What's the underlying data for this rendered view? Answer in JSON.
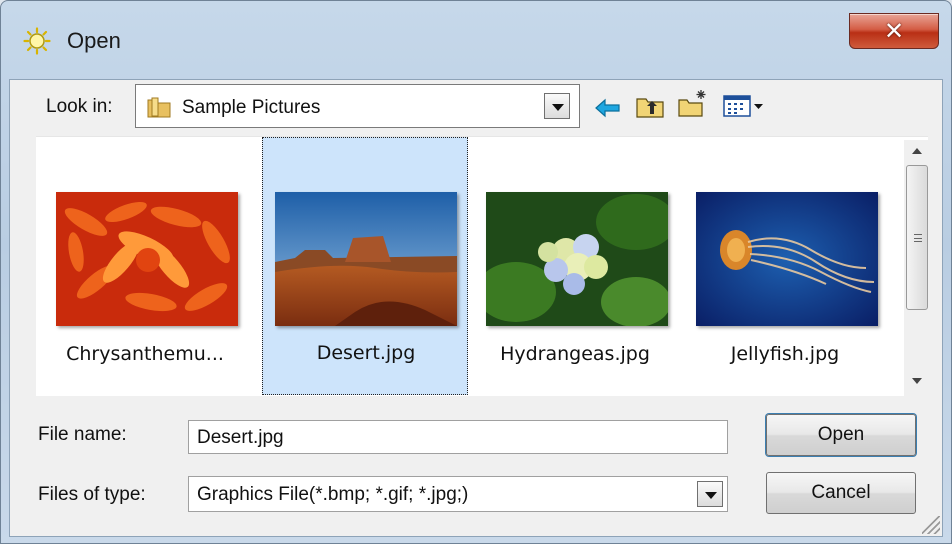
{
  "window": {
    "title": "Open",
    "close_glyph": "✕",
    "title_icon": "open-sun-icon"
  },
  "look_in": {
    "label": "Look in:",
    "value": "Sample Pictures",
    "icon": "folder-icon"
  },
  "toolbar": {
    "icons": [
      "back-arrow-icon",
      "up-folder-icon",
      "new-folder-icon",
      "view-menu-icon"
    ]
  },
  "files": [
    {
      "name": "Chrysanthemu...",
      "selected": false,
      "thumbnail": "orange chrysanthemum flower"
    },
    {
      "name": "Desert.jpg",
      "selected": true,
      "thumbnail": "desert butte landscape"
    },
    {
      "name": "Hydrangeas.jpg",
      "selected": false,
      "thumbnail": "hydrangea flowers"
    },
    {
      "name": "Jellyfish.jpg",
      "selected": false,
      "thumbnail": "jellyfish in blue water"
    }
  ],
  "file_name": {
    "label": "File name:",
    "value": "Desert.jpg"
  },
  "file_type": {
    "label": "Files of type:",
    "value": "Graphics File(*.bmp; *.gif; *.jpg;)"
  },
  "buttons": {
    "open": "Open",
    "cancel": "Cancel"
  },
  "colors": {
    "selection": "#cde4fb",
    "close_button": "#c9432a",
    "back_arrow": "#1ea6e0"
  }
}
